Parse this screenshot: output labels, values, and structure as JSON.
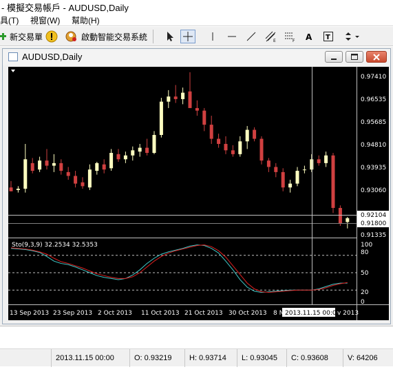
{
  "window": {
    "title": "- 模擬交易帳戶 - AUDUSD,Daily"
  },
  "menu": {
    "tools": "具(T)",
    "window": "視窗(W)",
    "help": "幫助(H)"
  },
  "toolbar": {
    "new_order": "新交易單",
    "expert": "啟動智能交易系統",
    "tools": [
      {
        "icon": "cursor-icon"
      },
      {
        "icon": "crosshair-icon"
      },
      {
        "icon": "vertical-line-icon"
      },
      {
        "icon": "horizontal-line-icon"
      },
      {
        "icon": "trendline-icon"
      },
      {
        "icon": "equidistant-channel-icon"
      },
      {
        "icon": "fibonacci-icon"
      },
      {
        "icon": "text-icon"
      },
      {
        "icon": "text-label-icon"
      },
      {
        "icon": "arrows-icon"
      }
    ]
  },
  "chart_window": {
    "title": "AUDUSD,Daily"
  },
  "chart": {
    "price_labels": [
      "0.97410",
      "0.96535",
      "0.95685",
      "0.94810",
      "0.93935",
      "0.93060",
      "0.92104",
      "0.91800",
      "0.91335"
    ],
    "current_price": "0.91800",
    "crosshair_price": "0.92104",
    "date_labels": [
      "13 Sep 2013",
      "23 Sep 2013",
      "2 Oct 2013",
      "11 Oct 2013",
      "21 Oct 2013",
      "30 Oct 2013",
      "8 N",
      "v 2013"
    ],
    "crosshair_date": "2013.11.15 00:00",
    "indicator_label": "Sto(9,3,9) 32.2534 32.5353",
    "indicator_levels": [
      "100",
      "80",
      "50",
      "20",
      "0"
    ],
    "colors": {
      "bull": "#ffffc0",
      "bear": "#d04040",
      "main_line": "#40c8c8",
      "signal_line": "#e02020"
    }
  },
  "chart_data": {
    "type": "candlestick",
    "title": "AUDUSD,Daily",
    "ylim": [
      0.9115,
      0.9755
    ],
    "candles": [
      {
        "o": 0.93,
        "h": 0.9325,
        "l": 0.9285,
        "c": 0.9285
      },
      {
        "o": 0.929,
        "h": 0.9305,
        "l": 0.928,
        "c": 0.9295
      },
      {
        "o": 0.9295,
        "h": 0.947,
        "l": 0.928,
        "c": 0.941
      },
      {
        "o": 0.9395,
        "h": 0.9415,
        "l": 0.9355,
        "c": 0.9365
      },
      {
        "o": 0.937,
        "h": 0.942,
        "l": 0.936,
        "c": 0.9405
      },
      {
        "o": 0.9405,
        "h": 0.945,
        "l": 0.937,
        "c": 0.9385
      },
      {
        "o": 0.9385,
        "h": 0.943,
        "l": 0.936,
        "c": 0.9395
      },
      {
        "o": 0.9395,
        "h": 0.941,
        "l": 0.935,
        "c": 0.9365
      },
      {
        "o": 0.936,
        "h": 0.938,
        "l": 0.933,
        "c": 0.9345
      },
      {
        "o": 0.9345,
        "h": 0.9365,
        "l": 0.93,
        "c": 0.9315
      },
      {
        "o": 0.932,
        "h": 0.934,
        "l": 0.9295,
        "c": 0.9305
      },
      {
        "o": 0.93,
        "h": 0.939,
        "l": 0.929,
        "c": 0.937
      },
      {
        "o": 0.9365,
        "h": 0.94,
        "l": 0.935,
        "c": 0.9395
      },
      {
        "o": 0.939,
        "h": 0.941,
        "l": 0.9355,
        "c": 0.937
      },
      {
        "o": 0.9375,
        "h": 0.945,
        "l": 0.9365,
        "c": 0.9435
      },
      {
        "o": 0.943,
        "h": 0.945,
        "l": 0.94,
        "c": 0.941
      },
      {
        "o": 0.941,
        "h": 0.944,
        "l": 0.9395,
        "c": 0.9425
      },
      {
        "o": 0.9425,
        "h": 0.946,
        "l": 0.9405,
        "c": 0.9445
      },
      {
        "o": 0.944,
        "h": 0.947,
        "l": 0.942,
        "c": 0.9455
      },
      {
        "o": 0.9455,
        "h": 0.949,
        "l": 0.9425,
        "c": 0.9435
      },
      {
        "o": 0.9435,
        "h": 0.952,
        "l": 0.943,
        "c": 0.9505
      },
      {
        "o": 0.9505,
        "h": 0.965,
        "l": 0.9495,
        "c": 0.9635
      },
      {
        "o": 0.9635,
        "h": 0.968,
        "l": 0.961,
        "c": 0.9655
      },
      {
        "o": 0.9655,
        "h": 0.97,
        "l": 0.963,
        "c": 0.9645
      },
      {
        "o": 0.9645,
        "h": 0.969,
        "l": 0.9625,
        "c": 0.967
      },
      {
        "o": 0.9675,
        "h": 0.975,
        "l": 0.964,
        "c": 0.961
      },
      {
        "o": 0.961,
        "h": 0.964,
        "l": 0.958,
        "c": 0.96
      },
      {
        "o": 0.96,
        "h": 0.961,
        "l": 0.952,
        "c": 0.9545
      },
      {
        "o": 0.9545,
        "h": 0.958,
        "l": 0.947,
        "c": 0.949
      },
      {
        "o": 0.949,
        "h": 0.951,
        "l": 0.9455,
        "c": 0.947
      },
      {
        "o": 0.947,
        "h": 0.95,
        "l": 0.943,
        "c": 0.9445
      },
      {
        "o": 0.9445,
        "h": 0.9465,
        "l": 0.942,
        "c": 0.943
      },
      {
        "o": 0.943,
        "h": 0.95,
        "l": 0.942,
        "c": 0.948
      },
      {
        "o": 0.948,
        "h": 0.954,
        "l": 0.945,
        "c": 0.9525
      },
      {
        "o": 0.9525,
        "h": 0.9535,
        "l": 0.948,
        "c": 0.949
      },
      {
        "o": 0.949,
        "h": 0.95,
        "l": 0.939,
        "c": 0.9405
      },
      {
        "o": 0.9405,
        "h": 0.9415,
        "l": 0.936,
        "c": 0.938
      },
      {
        "o": 0.938,
        "h": 0.9395,
        "l": 0.934,
        "c": 0.936
      },
      {
        "o": 0.936,
        "h": 0.9375,
        "l": 0.9285,
        "c": 0.93
      },
      {
        "o": 0.93,
        "h": 0.933,
        "l": 0.928,
        "c": 0.9315
      },
      {
        "o": 0.9315,
        "h": 0.938,
        "l": 0.9305,
        "c": 0.9365
      },
      {
        "o": 0.937,
        "h": 0.9385,
        "l": 0.9355,
        "c": 0.937
      },
      {
        "o": 0.937,
        "h": 0.943,
        "l": 0.936,
        "c": 0.941
      },
      {
        "o": 0.941,
        "h": 0.9425,
        "l": 0.9385,
        "c": 0.9395
      },
      {
        "o": 0.9395,
        "h": 0.944,
        "l": 0.938,
        "c": 0.9425
      },
      {
        "o": 0.9425,
        "h": 0.9435,
        "l": 0.92,
        "c": 0.922
      },
      {
        "o": 0.922,
        "h": 0.923,
        "l": 0.915,
        "c": 0.916
      },
      {
        "o": 0.9165,
        "h": 0.9185,
        "l": 0.914,
        "c": 0.918
      }
    ],
    "stochastic": {
      "main": [
        92,
        91,
        90,
        88,
        85,
        78,
        70,
        66,
        64,
        60,
        55,
        50,
        45,
        42,
        40,
        38,
        40,
        46,
        55,
        66,
        75,
        82,
        86,
        89,
        92,
        96,
        98,
        97,
        92,
        84,
        70,
        55,
        38,
        25,
        18,
        16,
        17,
        18,
        19,
        20,
        20,
        20,
        20,
        22,
        26,
        30,
        32,
        32
      ],
      "signal": [
        93,
        92,
        91,
        89,
        86,
        82,
        75,
        69,
        66,
        62,
        58,
        53,
        48,
        45,
        42,
        40,
        40,
        43,
        50,
        60,
        70,
        78,
        84,
        88,
        91,
        94,
        97,
        98,
        95,
        88,
        77,
        62,
        47,
        32,
        22,
        17,
        16,
        17,
        18,
        19,
        20,
        20,
        20,
        21,
        24,
        28,
        31,
        33
      ]
    }
  },
  "statusbar": {
    "date": "2013.11.15 00:00",
    "open": "O: 0.93219",
    "high": "H: 0.93714",
    "low": "L: 0.93045",
    "close": "C: 0.93608",
    "volume": "V: 64206"
  }
}
